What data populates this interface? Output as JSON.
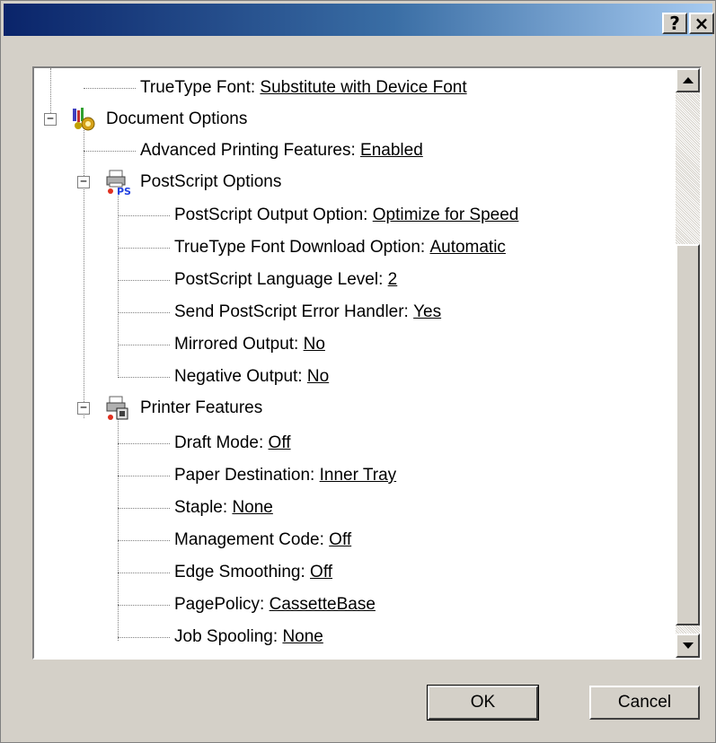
{
  "titlebar": {
    "help_label": "?",
    "close_label": "×"
  },
  "tree": {
    "items": [
      {
        "label": "TrueType Font:",
        "value": "Substitute with Device Font"
      },
      {
        "label": "Document Options",
        "icon": "document-options-icon"
      },
      {
        "label": "Advanced Printing Features:",
        "value": "Enabled"
      },
      {
        "label": "PostScript Options",
        "icon": "postscript-printer-icon"
      },
      {
        "label": "PostScript Output Option:",
        "value": "Optimize for Speed"
      },
      {
        "label": "TrueType Font Download Option:",
        "value": "Automatic"
      },
      {
        "label": "PostScript Language Level:",
        "value": "2"
      },
      {
        "label": "Send PostScript Error Handler:",
        "value": "Yes"
      },
      {
        "label": "Mirrored Output:",
        "value": "No"
      },
      {
        "label": "Negative Output:",
        "value": "No"
      },
      {
        "label": "Printer Features",
        "icon": "printer-features-icon"
      },
      {
        "label": "Draft Mode:",
        "value": "Off"
      },
      {
        "label": "Paper Destination:",
        "value": "Inner Tray"
      },
      {
        "label": "Staple:",
        "value": "None"
      },
      {
        "label": "Management Code:",
        "value": "Off"
      },
      {
        "label": "Edge Smoothing:",
        "value": "Off"
      },
      {
        "label": "PagePolicy:",
        "value": "CassetteBase"
      },
      {
        "label": "Job Spooling:",
        "value": "None"
      }
    ]
  },
  "buttons": {
    "ok": "OK",
    "cancel": "Cancel"
  },
  "colors": {
    "title_start": "#0a246a",
    "title_end": "#a6caf0",
    "face": "#d4d0c8"
  }
}
